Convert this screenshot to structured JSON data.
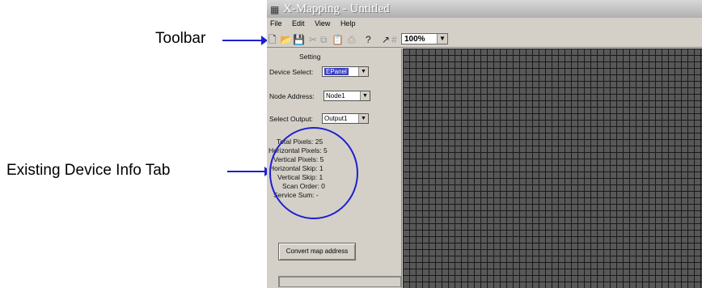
{
  "annotations": {
    "toolbar": "Toolbar",
    "device_info": "Existing Device Info Tab"
  },
  "window": {
    "title": "X-Mapping - Untitled",
    "icon": "app-grid-icon"
  },
  "menu": [
    "File",
    "Edit",
    "View",
    "Help"
  ],
  "toolbar": {
    "zoom": "100%",
    "icons": [
      "new-icon",
      "open-icon",
      "save-icon",
      "cut-icon",
      "copy-icon",
      "paste-icon",
      "print-icon",
      "help-icon",
      "pointer-icon",
      "grid-icon"
    ]
  },
  "setting": {
    "header": "Setting",
    "device_label": "Device Select:",
    "device_value": "EPanel",
    "node_label": "Node Address:",
    "node_value": "Node1",
    "output_label": "Select Output:",
    "output_value": "Output1"
  },
  "info": {
    "total_pixels": "Total Pixels: 25",
    "horizontal_pixels": "Horizontal Pixels: 5",
    "vertical_pixels": "Vertical Pixels: 5",
    "horizontal_skip": "Horizontal Skip: 1",
    "vertical_skip": "Vertical Skip: 1",
    "scan_order": "Scan Order: 0",
    "service_sum": "Service Sum: -"
  },
  "convert_button": "Convert map address",
  "progress": 0,
  "colors": {
    "annotation": "#1f1fd0",
    "grid_fill": "#585858",
    "grid_line": "#1a1a1a",
    "panel": "#d4d0c8"
  }
}
